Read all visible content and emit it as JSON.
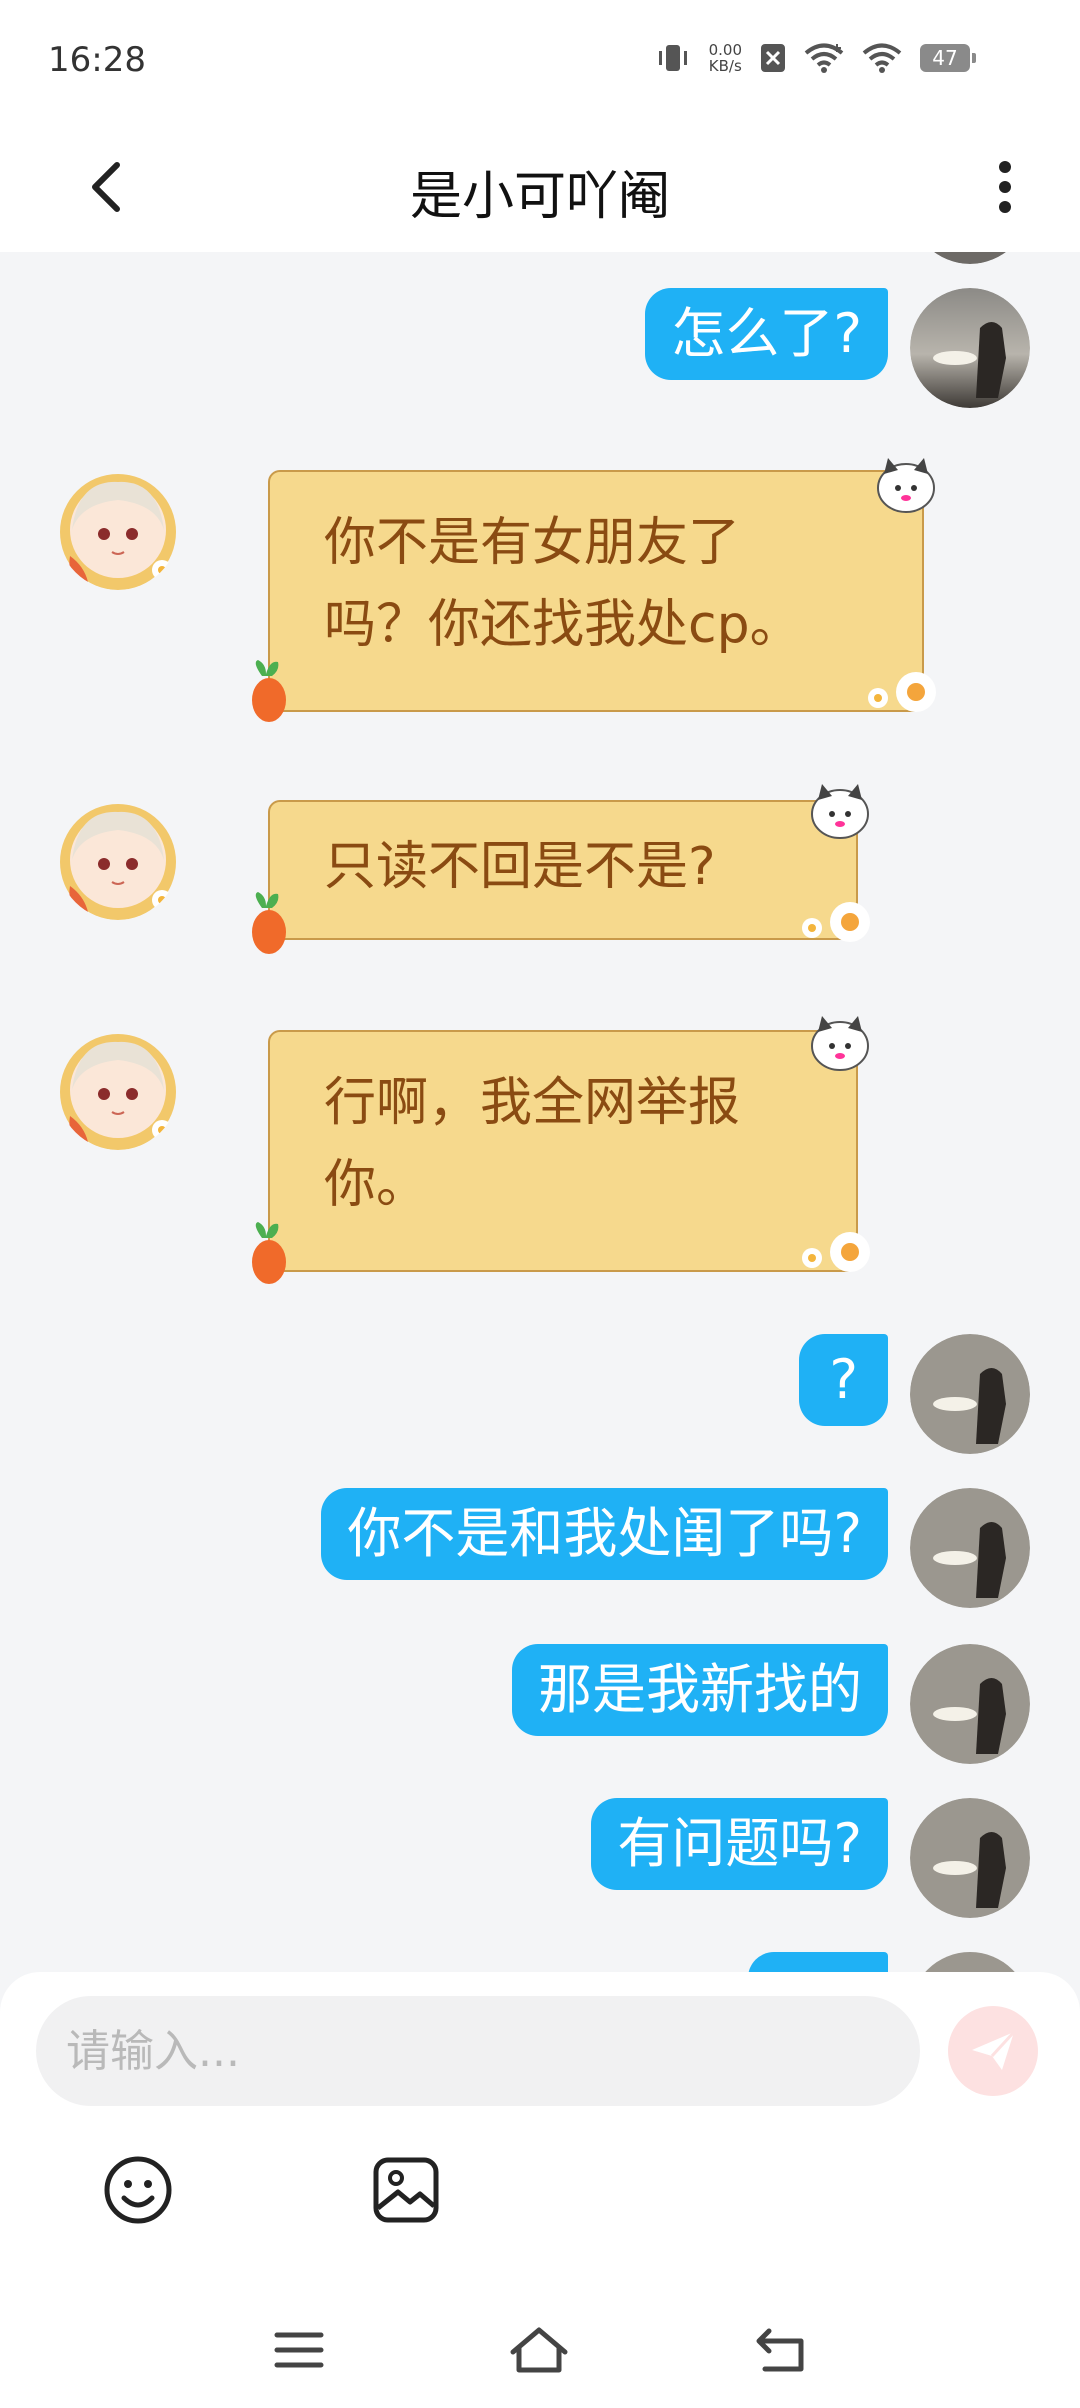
{
  "status_bar": {
    "time": "16:28",
    "net_speed_value": "0.00",
    "net_speed_unit": "KB/s",
    "battery": "47"
  },
  "header": {
    "title": "是小可吖阉"
  },
  "messages": [
    {
      "from": "me",
      "text": "怎么了?"
    },
    {
      "from": "her",
      "line1": "你不是有女朋友了",
      "line2": "吗？你还找我处cp。"
    },
    {
      "from": "her",
      "line1": "只读不回是不是?"
    },
    {
      "from": "her",
      "line1": "行啊，我全网举报",
      "line2": "你。"
    },
    {
      "from": "me",
      "text": "?"
    },
    {
      "from": "me",
      "text": "你不是和我处闺了吗?"
    },
    {
      "from": "me",
      "text": "那是我新找的"
    },
    {
      "from": "me",
      "text": "有问题吗?"
    }
  ],
  "composer": {
    "placeholder": "请输入..."
  },
  "colors": {
    "my_bubble": "#1fb1f5",
    "her_bubble": "#f6d98d",
    "her_text": "#8a4b12",
    "send_button": "#fde1e1"
  }
}
